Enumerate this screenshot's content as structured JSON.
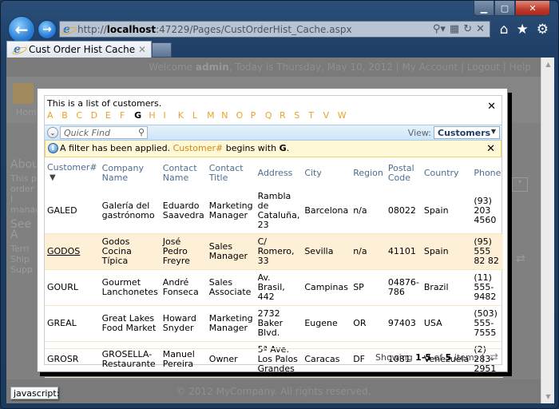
{
  "browser": {
    "url_prefix": "http://",
    "url_host": "localhost",
    "url_rest": ":47229/Pages/CustOrderHist_Cache.aspx",
    "tab_title": "Cust Order Hist Cache",
    "status_tooltip": "javascript:",
    "icons": {
      "back": "arrow-left-icon",
      "forward": "arrow-right-icon",
      "search": "search-icon",
      "compat": "compatibility-view-icon",
      "refresh": "refresh-icon",
      "stop": "stop-icon",
      "home": "home-icon",
      "favorites": "star-icon",
      "tools": "gear-icon"
    }
  },
  "background_page": {
    "welcome_prefix": "Welcome ",
    "user": "admin",
    "welcome_suffix": ", Today is Thursday, May 10, 2012 | My Account | Logout | Help",
    "home": "Home",
    "side_heading": "About",
    "side_text": "This p order l manag",
    "see_also": "See A",
    "side_links": [
      "Terri",
      "Ship",
      "Supp"
    ],
    "footer": "© 2012 MyCompany. All rights reserved."
  },
  "modal": {
    "description": "This is a list of customers.",
    "letters": [
      "A",
      "B",
      "C",
      "D",
      "E",
      "F",
      "G",
      "H",
      "I",
      "K",
      "L",
      "M",
      "N",
      "O",
      "P",
      "Q",
      "R",
      "S",
      "T",
      "V",
      "W"
    ],
    "active_letter": "G",
    "quick_find_placeholder": "Quick Find",
    "view_label": "View:",
    "view_value": "Customers",
    "filter_notice": {
      "prefix": "A filter has been applied. ",
      "field": "Customer#",
      "middle": " begins with ",
      "value": "G",
      "suffix": "."
    },
    "columns": [
      "Customer#",
      "Company Name",
      "Contact Name",
      "Contact Title",
      "Address",
      "City",
      "Region",
      "Postal Code",
      "Country",
      "Phone"
    ],
    "rows": [
      {
        "id": "GALED",
        "company": "Galería del gastrónomo",
        "contact": "Eduardo Saavedra",
        "title": "Marketing Manager",
        "address": "Rambla de Cataluña, 23",
        "city": "Barcelona",
        "region": "n/a",
        "postal": "08022",
        "country": "Spain",
        "phone": "(93) 203 4560"
      },
      {
        "id": "GODOS",
        "company": "Godos Cocina Típica",
        "contact": "José Pedro Freyre",
        "title": "Sales Manager",
        "address": "C/ Romero, 33",
        "city": "Sevilla",
        "region": "n/a",
        "postal": "41101",
        "country": "Spain",
        "phone": "(95) 555 82 82"
      },
      {
        "id": "GOURL",
        "company": "Gourmet Lanchonetes",
        "contact": "André Fonseca",
        "title": "Sales Associate",
        "address": "Av. Brasil, 442",
        "city": "Campinas",
        "region": "SP",
        "postal": "04876-786",
        "country": "Brazil",
        "phone": "(11) 555-9482"
      },
      {
        "id": "GREAL",
        "company": "Great Lakes Food Market",
        "contact": "Howard Snyder",
        "title": "Marketing Manager",
        "address": "2732 Baker Blvd.",
        "city": "Eugene",
        "region": "OR",
        "postal": "97403",
        "country": "USA",
        "phone": "(503) 555-7555"
      },
      {
        "id": "GROSR",
        "company": "GROSELLA-Restaurante",
        "contact": "Manuel Pereira",
        "title": "Owner",
        "address": "5ª Ave. Los Palos Grandes",
        "city": "Caracas",
        "region": "DF",
        "postal": "1081",
        "country": "Venezuela",
        "phone": "(2) 283-2951"
      }
    ],
    "selected_row": "GODOS",
    "pager": {
      "prefix": "Showing ",
      "range": "1-5",
      "of": " of ",
      "total": "5",
      "suffix": " items | "
    }
  }
}
